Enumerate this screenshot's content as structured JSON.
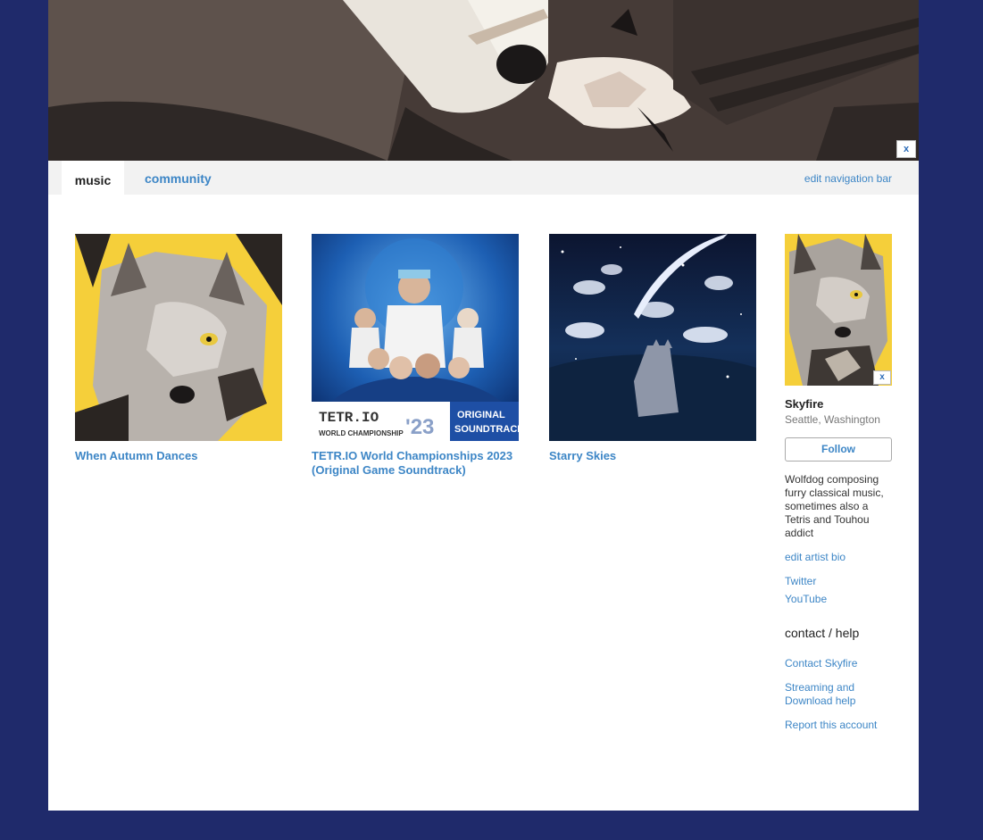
{
  "banner": {
    "close_label": "x"
  },
  "nav": {
    "tabs": [
      {
        "label": "music"
      },
      {
        "label": "community"
      }
    ],
    "edit_label": "edit navigation bar"
  },
  "albums": [
    {
      "title": "When Autumn Dances"
    },
    {
      "title": "TETR.IO World Championships 2023 (Original Game Soundtrack)",
      "cover_text": {
        "logo": "TETR.IO",
        "subtitle": "WORLD CHAMPIONSHIP",
        "year": "'23",
        "ost_line1": "ORIGINAL",
        "ost_line2": "SOUNDTRACK"
      }
    },
    {
      "title": "Starry Skies"
    }
  ],
  "artist": {
    "photo_close_label": "x",
    "name": "Skyfire",
    "location": "Seattle, Washington",
    "follow_label": "Follow",
    "bio": "Wolfdog composing furry classical music, sometimes also a Tetris and Touhou addict",
    "edit_bio_label": "edit artist bio",
    "links": [
      {
        "label": "Twitter"
      },
      {
        "label": "YouTube"
      }
    ],
    "contact_heading": "contact / help",
    "contact_label": "Contact Skyfire",
    "help_label": "Streaming and Download help",
    "report_label": "Report this account"
  },
  "colors": {
    "background": "#1f2a6b",
    "link": "#3d86c6",
    "navbar": "#f2f2f2",
    "album1_bg": "#f5cf3a",
    "album2_bg": "#1b4fa0",
    "album3_bg": "#0f1d3a"
  }
}
